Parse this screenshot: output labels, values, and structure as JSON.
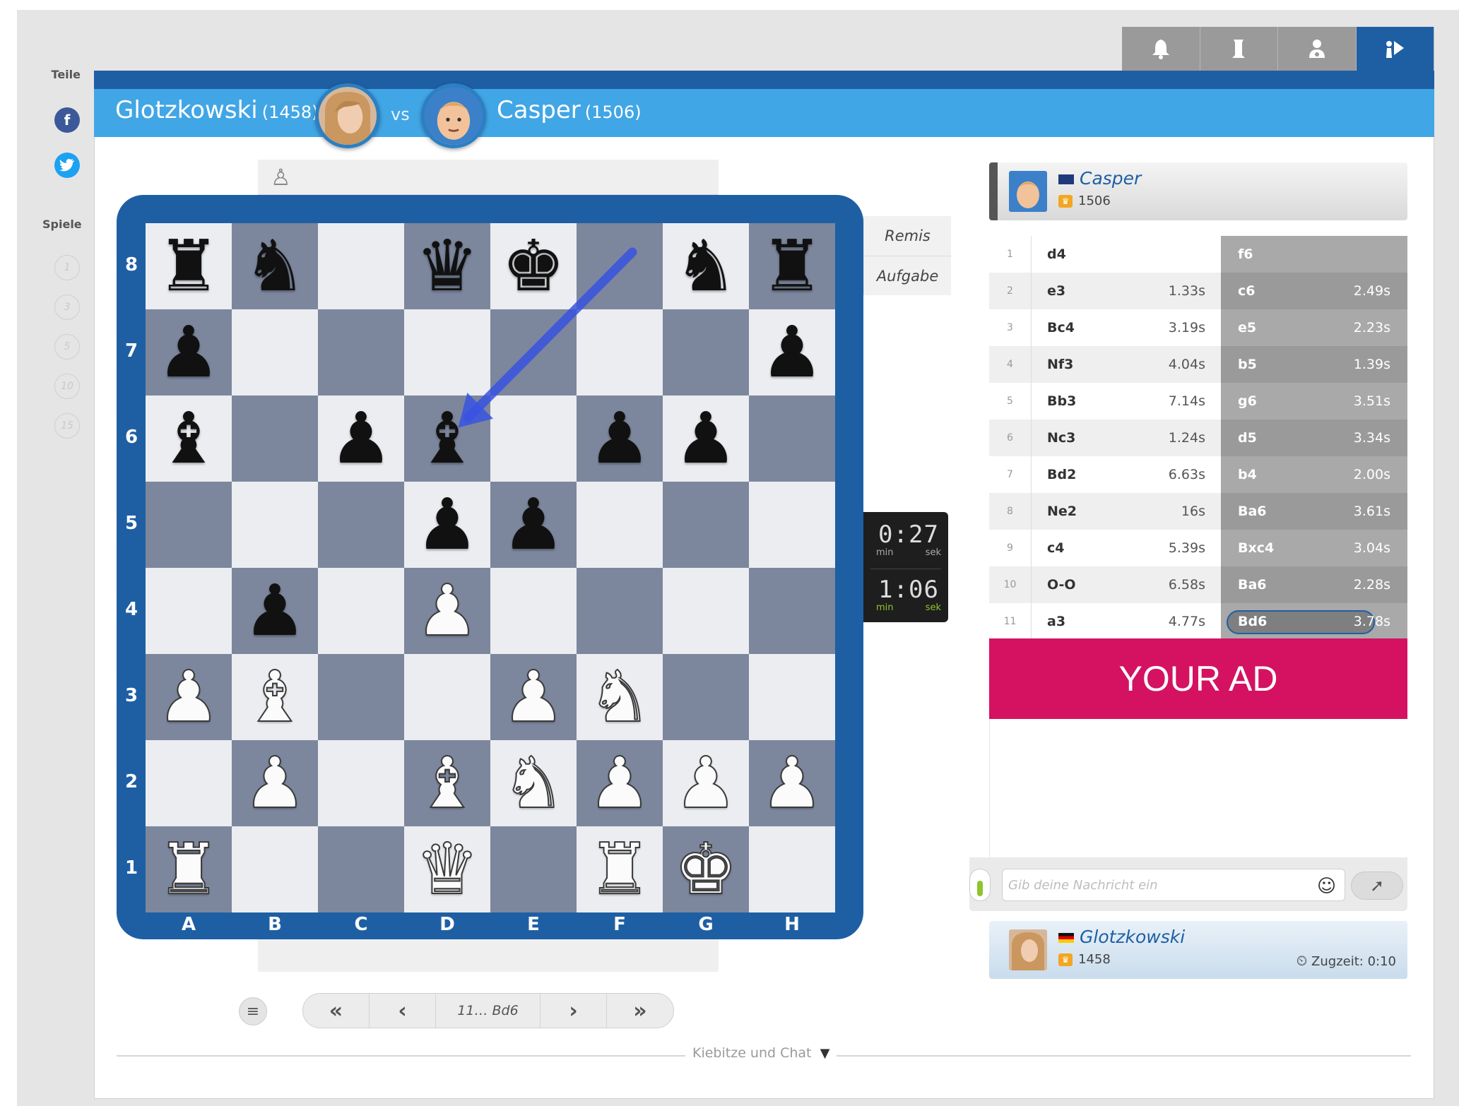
{
  "header": {
    "player_white": "Glotzkowski",
    "player_white_rating": "(1458)",
    "vs": "vs",
    "player_black": "Casper",
    "player_black_rating": "(1506)"
  },
  "tabs": [
    {
      "name": "bell-icon"
    },
    {
      "name": "tower-icon"
    },
    {
      "name": "users-icon"
    },
    {
      "name": "play-icon",
      "active": true
    }
  ],
  "sidebar": {
    "share_label": "Teile",
    "games_label": "Spiele",
    "facebook": "f",
    "twitter": "t",
    "game_counts": [
      "1",
      "3",
      "5",
      "10",
      "15"
    ]
  },
  "board": {
    "files": [
      "A",
      "B",
      "C",
      "D",
      "E",
      "F",
      "G",
      "H"
    ],
    "ranks": [
      "8",
      "7",
      "6",
      "5",
      "4",
      "3",
      "2",
      "1"
    ],
    "top_strip_icon": "♙",
    "position": [
      [
        "bR",
        "bN",
        "",
        "bQ",
        "bK",
        "",
        "bN",
        "bR"
      ],
      [
        "bP",
        "",
        "",
        "",
        "",
        "",
        "",
        "bP"
      ],
      [
        "bB",
        "",
        "bP",
        "bB",
        "",
        "bP",
        "bP",
        ""
      ],
      [
        "",
        "",
        "",
        "bP",
        "bP",
        "",
        "",
        ""
      ],
      [
        "",
        "bP",
        "",
        "wP",
        "",
        "",
        "",
        ""
      ],
      [
        "wP",
        "wB",
        "",
        "",
        "wP",
        "wN",
        "",
        ""
      ],
      [
        "",
        "wP",
        "",
        "wB",
        "wN",
        "wP",
        "wP",
        "wP"
      ],
      [
        "wR",
        "",
        "",
        "wQ",
        "",
        "wR",
        "wK",
        ""
      ]
    ],
    "last_move": {
      "from": "f8",
      "to": "d6"
    },
    "arrow_color": "#3a53e0"
  },
  "side_buttons": {
    "draw": "Remis",
    "resign": "Aufgabe"
  },
  "clock": {
    "top_time": "0:27",
    "bottom_time": "1:06",
    "min": "min",
    "sek": "sek"
  },
  "nav": {
    "menu": "≡",
    "first": "«",
    "prev": "‹",
    "current": "11… Bd6",
    "next": "›",
    "last": "»"
  },
  "kibitz_label": "Kiebitze und Chat",
  "opponent": {
    "name": "Casper",
    "rating": "1506"
  },
  "me": {
    "name": "Glotzkowski",
    "rating": "1458",
    "zugzeit": "Zugzeit: 0:10"
  },
  "moves": [
    {
      "n": "1",
      "w": "d4",
      "wt": "",
      "b": "f6",
      "bt": ""
    },
    {
      "n": "2",
      "w": "e3",
      "wt": "1.33s",
      "b": "c6",
      "bt": "2.49s"
    },
    {
      "n": "3",
      "w": "Bc4",
      "wt": "3.19s",
      "b": "e5",
      "bt": "2.23s"
    },
    {
      "n": "4",
      "w": "Nf3",
      "wt": "4.04s",
      "b": "b5",
      "bt": "1.39s"
    },
    {
      "n": "5",
      "w": "Bb3",
      "wt": "7.14s",
      "b": "g6",
      "bt": "3.51s"
    },
    {
      "n": "6",
      "w": "Nc3",
      "wt": "1.24s",
      "b": "d5",
      "bt": "3.34s"
    },
    {
      "n": "7",
      "w": "Bd2",
      "wt": "6.63s",
      "b": "b4",
      "bt": "2.00s"
    },
    {
      "n": "8",
      "w": "Ne2",
      "wt": "16s",
      "b": "Ba6",
      "bt": "3.61s"
    },
    {
      "n": "9",
      "w": "c4",
      "wt": "5.39s",
      "b": "Bxc4",
      "bt": "3.04s"
    },
    {
      "n": "10",
      "w": "O-O",
      "wt": "6.58s",
      "b": "Ba6",
      "bt": "2.28s"
    },
    {
      "n": "11",
      "w": "a3",
      "wt": "4.77s",
      "b": "Bd6",
      "bt": "3.78s",
      "selected": true
    }
  ],
  "ad": {
    "text": "YOUR AD",
    "color": "#d41261"
  },
  "chat": {
    "placeholder": "Gib deine Nachricht ein",
    "smiley": "☺",
    "send": "➚"
  },
  "colors": {
    "brand_dark": "#1e5fa4",
    "brand_light": "#41a6e6",
    "board_dark": "#7c879d",
    "board_light": "#ebedf1"
  }
}
